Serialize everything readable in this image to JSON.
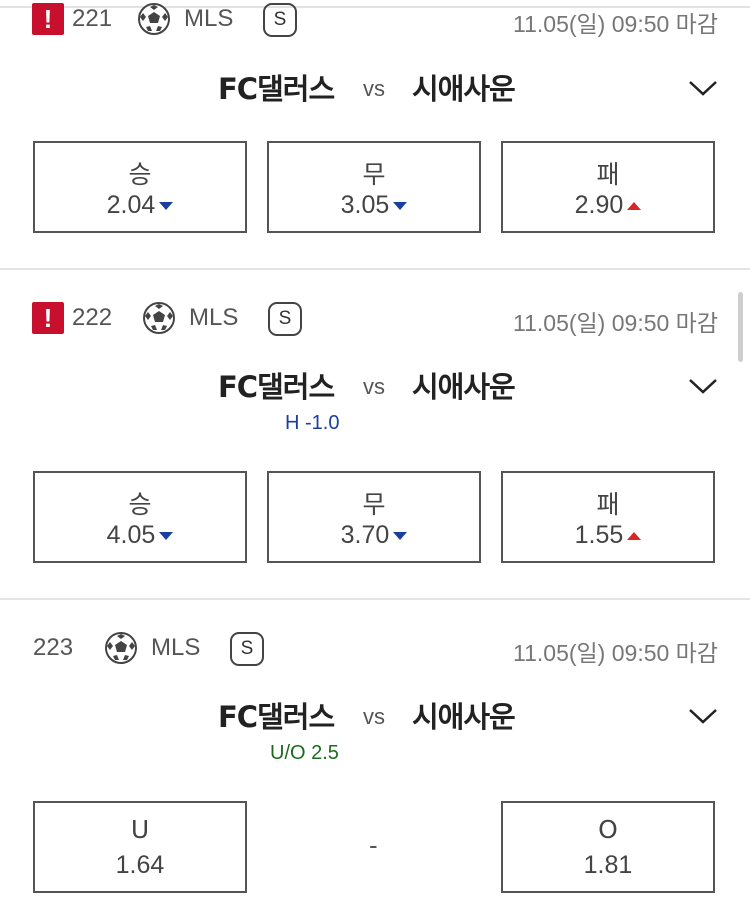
{
  "matches": [
    {
      "alert": "!",
      "number": "221",
      "league": "MLS",
      "badge": "S",
      "deadline": "11.05(일) 09:50 마감",
      "home": "FC댈러스",
      "vs": "vs",
      "away": "시애사운",
      "handicap": "",
      "odds": [
        {
          "label": "승",
          "value": "2.04",
          "trend": "down"
        },
        {
          "label": "무",
          "value": "3.05",
          "trend": "down"
        },
        {
          "label": "패",
          "value": "2.90",
          "trend": "up"
        }
      ]
    },
    {
      "alert": "!",
      "number": "222",
      "league": "MLS",
      "badge": "S",
      "deadline": "11.05(일) 09:50 마감",
      "home": "FC댈러스",
      "vs": "vs",
      "away": "시애사운",
      "handicap": "H -1.0",
      "handicap_color": "#1a3fa0",
      "odds": [
        {
          "label": "승",
          "value": "4.05",
          "trend": "down"
        },
        {
          "label": "무",
          "value": "3.70",
          "trend": "down"
        },
        {
          "label": "패",
          "value": "1.55",
          "trend": "up"
        }
      ]
    },
    {
      "alert": "",
      "number": "223",
      "league": "MLS",
      "badge": "S",
      "deadline": "11.05(일) 09:50 마감",
      "home": "FC댈러스",
      "vs": "vs",
      "away": "시애사운",
      "handicap": "U/O 2.5",
      "handicap_color": "#1e6b1e",
      "odds": [
        {
          "label": "U",
          "value": "1.64",
          "trend": ""
        },
        {
          "label": "-",
          "value": "",
          "trend": ""
        },
        {
          "label": "O",
          "value": "1.81",
          "trend": ""
        }
      ]
    }
  ],
  "colors": {
    "alert": "#c8102e",
    "trend_down": "#1a3fa0",
    "trend_up": "#d62828"
  },
  "icons": {
    "alert": "alert-icon",
    "ball": "soccer-ball-icon",
    "chevron": "chevron-down-icon"
  }
}
